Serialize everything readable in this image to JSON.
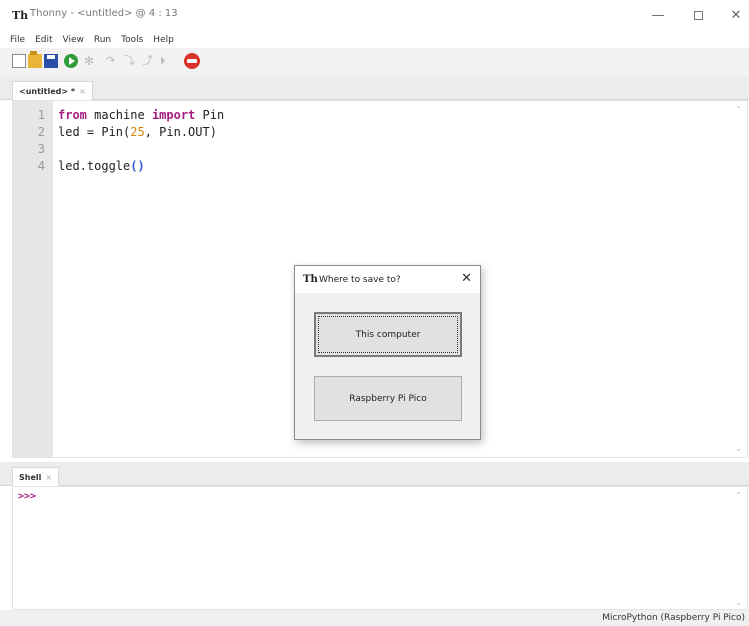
{
  "window": {
    "title": "Thonny  -  <untitled>  @  4 : 13",
    "minimize": "—",
    "close": "✕"
  },
  "menu": [
    "File",
    "Edit",
    "View",
    "Run",
    "Tools",
    "Help"
  ],
  "toolbar": {
    "icons": [
      "new-file-icon",
      "open-folder-icon",
      "save-icon",
      "run-icon",
      "debug-icon",
      "step-over-icon",
      "step-into-icon",
      "step-out-icon",
      "resume-icon",
      "stop-icon"
    ],
    "stop_color": "#d9302a",
    "run_color": "#2f9a3a"
  },
  "editor": {
    "tab_label": "<untitled> *",
    "tab_close": "×",
    "line_numbers": [
      "1",
      "2",
      "3",
      "4"
    ],
    "lines": {
      "l1_kw1": "from",
      "l1_mod": " machine ",
      "l1_kw2": "import",
      "l1_name": " Pin",
      "l2_a": "led = Pin(",
      "l2_num": "25",
      "l2_b": ", Pin.OUT)",
      "l4_a": "led.toggle",
      "l4_paren": "()"
    },
    "keyword_color": "#a61d82"
  },
  "shell": {
    "tab_label": "Shell",
    "tab_close": "×",
    "prompt": ">>>"
  },
  "status": {
    "interpreter": "MicroPython (Raspberry Pi Pico)"
  },
  "dialog": {
    "title": "Where to save to?",
    "close": "✕",
    "option_computer": "This computer",
    "option_pico": "Raspberry Pi Pico"
  }
}
